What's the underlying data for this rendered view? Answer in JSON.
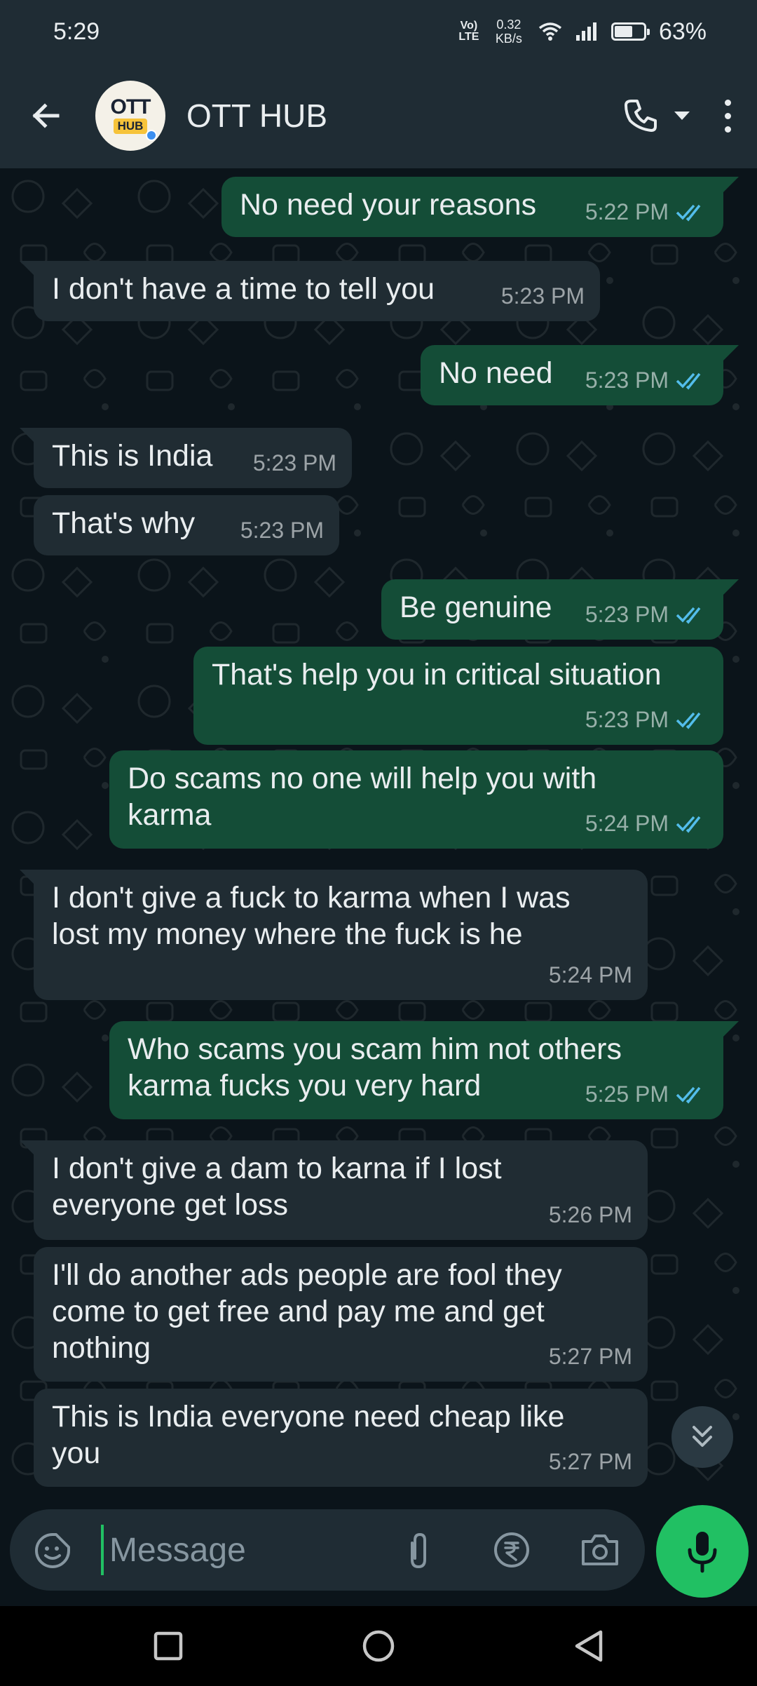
{
  "status_bar": {
    "time": "5:29",
    "network_type": "Vo) LTE",
    "net_speed_value": "0.32",
    "net_speed_unit": "KB/s",
    "battery_percent": "63%",
    "battery_level": 0.63
  },
  "header": {
    "contact_name": "OTT HUB",
    "avatar_logo_text": "OTT",
    "avatar_logo_subtext": "HUB"
  },
  "messages": [
    {
      "direction": "out",
      "text": "No need your reasons",
      "time": "5:22 PM",
      "read": true
    },
    {
      "direction": "in",
      "text": "I don't have a time to tell you",
      "time": "5:23 PM"
    },
    {
      "direction": "out",
      "text": "No need",
      "time": "5:23 PM",
      "read": true
    },
    {
      "direction": "in",
      "text": "This is India",
      "time": "5:23 PM"
    },
    {
      "direction": "in",
      "text": "That's why",
      "time": "5:23 PM"
    },
    {
      "direction": "out",
      "text": "Be genuine",
      "time": "5:23 PM",
      "read": true
    },
    {
      "direction": "out",
      "text": "That's help you in critical situation",
      "time": "5:23 PM",
      "read": true
    },
    {
      "direction": "out",
      "text_lines": [
        "Do scams no one will help you with",
        "karma"
      ],
      "time": "5:24 PM",
      "read": true
    },
    {
      "direction": "in",
      "text_lines": [
        "I don't give a fuck to karma when I was",
        "lost my money where the fuck is he"
      ],
      "time": "5:24 PM"
    },
    {
      "direction": "out",
      "text_lines": [
        "Who scams you scam him not others",
        "karma fucks you very hard"
      ],
      "time": "5:25 PM",
      "read": true
    },
    {
      "direction": "in",
      "text_lines": [
        "I don't give a dam to karna if I lost",
        "everyone get loss"
      ],
      "time": "5:26 PM"
    },
    {
      "direction": "in",
      "text_lines": [
        "I'll do another ads people are fool they",
        "come to get free and pay me and get",
        "nothing"
      ],
      "time": "5:27 PM"
    },
    {
      "direction": "in",
      "text_lines": [
        "This is India everyone need cheap like",
        "you"
      ],
      "time": "5:27 PM"
    }
  ],
  "composer": {
    "placeholder": "Message"
  },
  "icons": {
    "back": "arrow-left-icon",
    "call": "phone-icon",
    "menu": "more-vert-icon",
    "emoji": "sticker-icon",
    "attach": "paperclip-icon",
    "payment": "rupee-icon",
    "camera": "camera-icon",
    "mic": "microphone-icon",
    "scroll": "double-chevron-down-icon"
  },
  "colors": {
    "incoming_bubble": "#202c33",
    "outgoing_bubble": "#144d37",
    "read_ticks": "#53bdeb",
    "accent_green": "#21c063"
  }
}
